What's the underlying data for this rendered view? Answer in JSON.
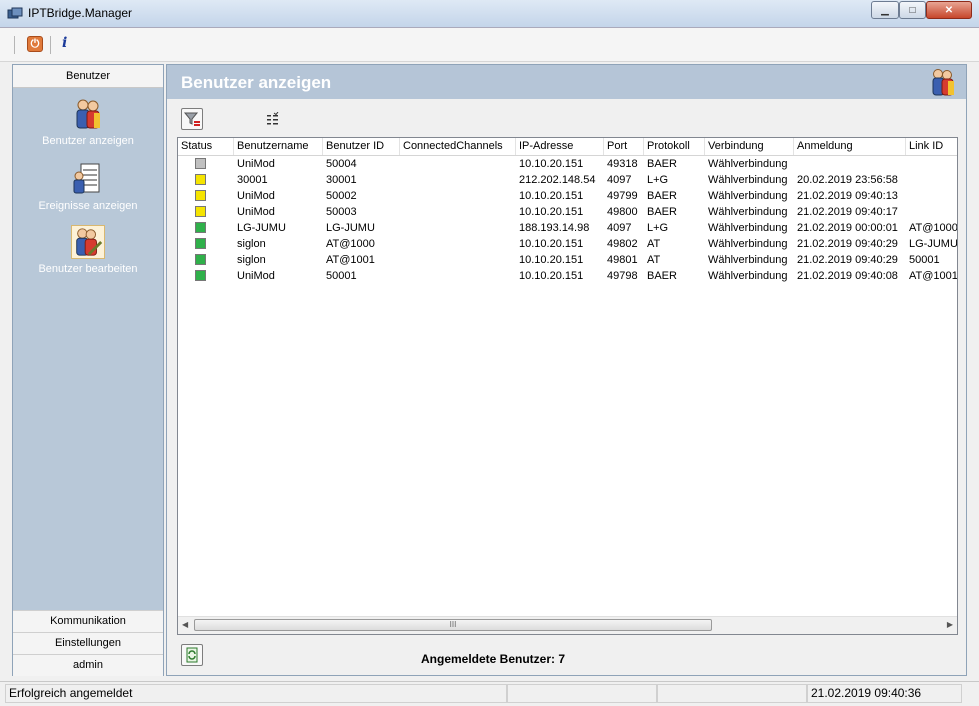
{
  "window": {
    "title": "IPTBridge.Manager",
    "minimize_glyph": "▁",
    "maximize_glyph": "□",
    "close_glyph": "✕"
  },
  "toolbar": {
    "power_icon": "power-icon",
    "power_glyph": "⏻",
    "info_icon": "info-icon",
    "info_glyph": "i"
  },
  "sidebar": {
    "header": "Benutzer",
    "items": [
      {
        "label": "Benutzer anzeigen",
        "icon": "users-icon"
      },
      {
        "label": "Ereignisse anzeigen",
        "icon": "events-icon"
      },
      {
        "label": "Benutzer bearbeiten",
        "icon": "edit-users-icon"
      }
    ],
    "bottom_tabs": [
      "Kommunikation",
      "Einstellungen",
      "admin"
    ]
  },
  "main": {
    "title": "Benutzer anzeigen",
    "count_label": "Angemeldete Benutzer: 7",
    "columns": [
      "Status",
      "Benutzername",
      "Benutzer ID",
      "ConnectedChannels",
      "IP-Adresse",
      "Port",
      "Protokoll",
      "Verbindung",
      "Anmeldung",
      "Link ID"
    ],
    "rows": [
      {
        "status": "#c0c0c0",
        "user": "UniMod",
        "id": "50004",
        "channels": "",
        "ip": "10.10.20.151",
        "port": "49318",
        "proto": "BAER",
        "conn": "Wählverbindung",
        "login": "",
        "link": ""
      },
      {
        "status": "#f5e400",
        "user": "30001",
        "id": "30001",
        "channels": "",
        "ip": "212.202.148.54",
        "port": "4097",
        "proto": "L+G",
        "conn": "Wählverbindung",
        "login": "20.02.2019 23:56:58",
        "link": ""
      },
      {
        "status": "#f5e400",
        "user": "UniMod",
        "id": "50002",
        "channels": "",
        "ip": "10.10.20.151",
        "port": "49799",
        "proto": "BAER",
        "conn": "Wählverbindung",
        "login": "21.02.2019 09:40:13",
        "link": ""
      },
      {
        "status": "#f5e400",
        "user": "UniMod",
        "id": "50003",
        "channels": "",
        "ip": "10.10.20.151",
        "port": "49800",
        "proto": "BAER",
        "conn": "Wählverbindung",
        "login": "21.02.2019 09:40:17",
        "link": ""
      },
      {
        "status": "#2fb04a",
        "user": "LG-JUMU",
        "id": "LG-JUMU",
        "channels": "",
        "ip": "188.193.14.98",
        "port": "4097",
        "proto": "L+G",
        "conn": "Wählverbindung",
        "login": "21.02.2019 00:00:01",
        "link": "AT@1000"
      },
      {
        "status": "#2fb04a",
        "user": "siglon",
        "id": "AT@1000",
        "channels": "",
        "ip": "10.10.20.151",
        "port": "49802",
        "proto": "AT",
        "conn": "Wählverbindung",
        "login": "21.02.2019 09:40:29",
        "link": "LG-JUMU"
      },
      {
        "status": "#2fb04a",
        "user": "siglon",
        "id": "AT@1001",
        "channels": "",
        "ip": "10.10.20.151",
        "port": "49801",
        "proto": "AT",
        "conn": "Wählverbindung",
        "login": "21.02.2019 09:40:29",
        "link": "50001"
      },
      {
        "status": "#2fb04a",
        "user": "UniMod",
        "id": "50001",
        "channels": "",
        "ip": "10.10.20.151",
        "port": "49798",
        "proto": "BAER",
        "conn": "Wählverbindung",
        "login": "21.02.2019 09:40:08",
        "link": "AT@1001"
      }
    ],
    "scroll_left": "◀",
    "scroll_right": "▶",
    "scroll_grip": "III"
  },
  "statusbar": {
    "message": "Erfolgreich angemeldet",
    "datetime": "21.02.2019 09:40:36"
  }
}
